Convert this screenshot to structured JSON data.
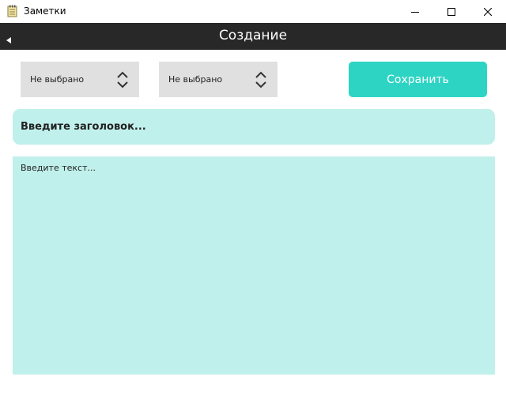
{
  "window": {
    "title": "Заметки",
    "icon": "notepad-icon",
    "controls": [
      "minimize-icon",
      "maximize-icon",
      "close-icon"
    ]
  },
  "header": {
    "back_icon": "back-triangle-icon",
    "title": "Создание",
    "background": "#282828"
  },
  "toolbar": {
    "select_1": {
      "value": "Не выбрано"
    },
    "select_2": {
      "value": "Не выбрано"
    },
    "save_label": "Сохранить",
    "accent": "#2dd4c4"
  },
  "editor": {
    "title_placeholder": "Введите заголовок...",
    "text_placeholder": "Введите текст...",
    "field_color": "#c0f0eb"
  }
}
